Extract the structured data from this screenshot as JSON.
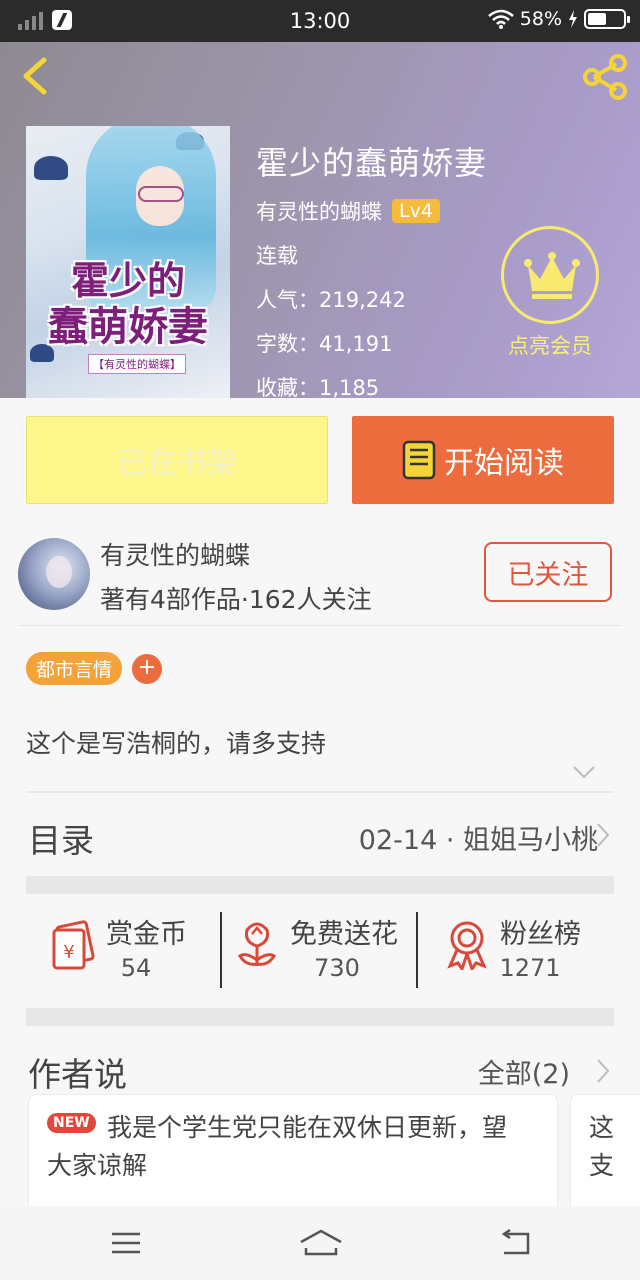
{
  "status_bar": {
    "time": "13:00",
    "battery": "58%",
    "battery_level": 0.58
  },
  "book": {
    "title": "霍少的蠢萌娇妻",
    "author": "有灵性的蝴蝶",
    "author_level": "Lv4",
    "state": "连载",
    "popularity": "人气：219,242",
    "words": "字数：41,191",
    "favorites": "收藏：1,185",
    "cover_title_line1": "霍少的",
    "cover_title_line2": "蠢萌娇妻",
    "cover_author": "【有灵性的蝴蝶】"
  },
  "vip": {
    "label": "点亮会员"
  },
  "actions": {
    "shelf_label": "已在书架",
    "read_label": "开始阅读"
  },
  "author_section": {
    "name": "有灵性的蝴蝶",
    "stats": "著有4部作品·162人关注",
    "follow_label": "已关注"
  },
  "tags": {
    "items": [
      "都市言情"
    ],
    "add": "+"
  },
  "description": "这个是写浩桐的，请多支持",
  "toc": {
    "label": "目录",
    "latest_chapter": "02-14 · 姐姐马小桃"
  },
  "stats": [
    {
      "label": "赏金币",
      "value": "54"
    },
    {
      "label": "免费送花",
      "value": "730"
    },
    {
      "label": "粉丝榜",
      "value": "1271"
    }
  ],
  "author_says": {
    "label": "作者说",
    "all_label": "全部(2)",
    "badge": "NEW",
    "post_text": "我是个学生党只能在双休日更新，望大家谅解",
    "second_post_text": "这支"
  },
  "colors": {
    "accent": "#ed6c3e",
    "shelf": "#fdf68b",
    "tag": "#f4a33a",
    "vip": "#f7ea6e"
  }
}
